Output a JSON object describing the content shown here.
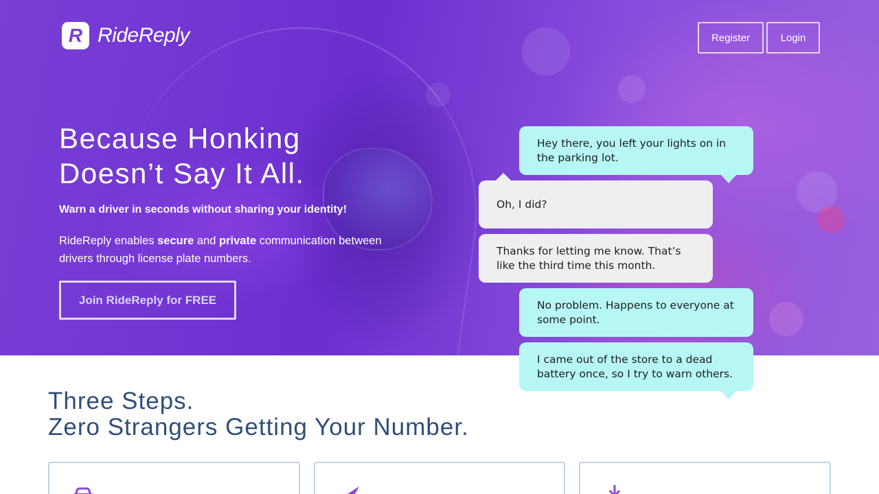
{
  "brand": {
    "name": "RideReply",
    "logo_letter": "R"
  },
  "nav": {
    "register_label": "Register",
    "login_label": "Login"
  },
  "hero": {
    "headline_line1": "Because Honking",
    "headline_line2": "Doesn’t Say It All.",
    "tagline": "Warn a driver in seconds without sharing your identity!",
    "description_part1": "RideReply enables ",
    "description_bold1": "secure",
    "description_part2": " and ",
    "description_bold2": "private",
    "description_part3": " communication between drivers through license plate numbers.",
    "cta_label": "Join RideReply for FREE"
  },
  "chat": [
    {
      "side": "right",
      "text": "Hey there, you left your lights on in the parking lot."
    },
    {
      "side": "left",
      "text": "Oh, I did?"
    },
    {
      "side": "left",
      "text": "Thanks for letting me know. That’s like the third time this month."
    },
    {
      "side": "right",
      "text": "No problem. Happens to everyone at some point."
    },
    {
      "side": "right",
      "text": "I came out of the store to a dead battery once, so I try to warn others."
    }
  ],
  "steps": {
    "title_line1": "Three Steps.",
    "title_line2": "Zero Strangers Getting Your Number.",
    "card_icons": [
      "car-icon",
      "send-icon",
      "download-icon"
    ]
  },
  "colors": {
    "brand_purple": "#7a3fd6",
    "bubble_teal": "#b6f7f5",
    "bubble_grey": "#efeff0",
    "section_title": "#2f4e79",
    "card_icon": "#8b47d8",
    "card_border": "#c2d3e3"
  }
}
